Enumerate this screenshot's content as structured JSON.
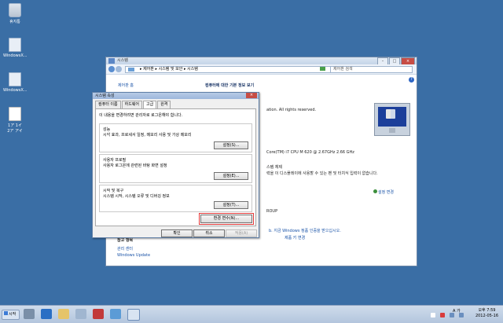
{
  "desktop": {
    "icons": [
      {
        "label": "휴지통"
      },
      {
        "label": "WindowsX..."
      },
      {
        "label": "WindowsX..."
      },
      {
        "label": "1ア 1イ\n2ア アイ"
      }
    ]
  },
  "main_window": {
    "title": "시스템",
    "breadcrumb": "▸ 제어판 ▸ 시스템 및 보안 ▸ 시스템",
    "search_placeholder": "제어판 검색",
    "control_panel_home": "제어판 홈",
    "page_title": "컴퓨터에 대한 기본 정보 보기",
    "rights_text": "ation. All rights reserved.",
    "cpu_text": "Core(TM) i7 CPU      M 620  @ 2.67GHz   2.66 GHz",
    "touch_note1": "스템 체제",
    "touch_note2": "력을 이 디스플레이에 사용할 수 있는 펜 및 터치식 입력이 없습니다.",
    "change_settings": "설정 변경",
    "workgroup": "ROUP",
    "activate_text": "b. 지금 Windows 정품 인증을 받으십시오.",
    "change_product_key": "제품 키 변경",
    "see_also": "참고 항목",
    "action_center": "관리 센터",
    "windows_update": "Windows Update",
    "help": "?"
  },
  "dialog": {
    "title": "시스템 속성",
    "close": "×",
    "tabs": [
      "컴퓨터 이름",
      "하드웨어",
      "고급",
      "원격"
    ],
    "selected_tab": "고급",
    "admin_note": "이 내용을 변경하려면 관리자로 로그온해야 합니다.",
    "groups": [
      {
        "title": "성능",
        "desc": "시각 효과, 프로세서 일정, 메모리 사용 및 가상 메모리",
        "button": "설정(S)..."
      },
      {
        "title": "사용자 프로필",
        "desc": "사용자 로그온에 관련된 바탕 화면 설정",
        "button": "설정(E)..."
      },
      {
        "title": "시작 및 복구",
        "desc": "시스템 시작, 시스템 오류 및 디버깅 정보",
        "button": "설정(T)..."
      }
    ],
    "env_button": "환경 변수(N)...",
    "ok": "확인",
    "cancel": "취소",
    "apply": "적용(A)"
  },
  "taskbar": {
    "start_label": "시작",
    "tray_lang": "A 가",
    "time": "오후 7:59",
    "date": "2012-05-16"
  },
  "colors": {
    "desktop": "#3a6ea5",
    "link": "#1b54a8",
    "highlight_outline": "#e23b3b"
  }
}
